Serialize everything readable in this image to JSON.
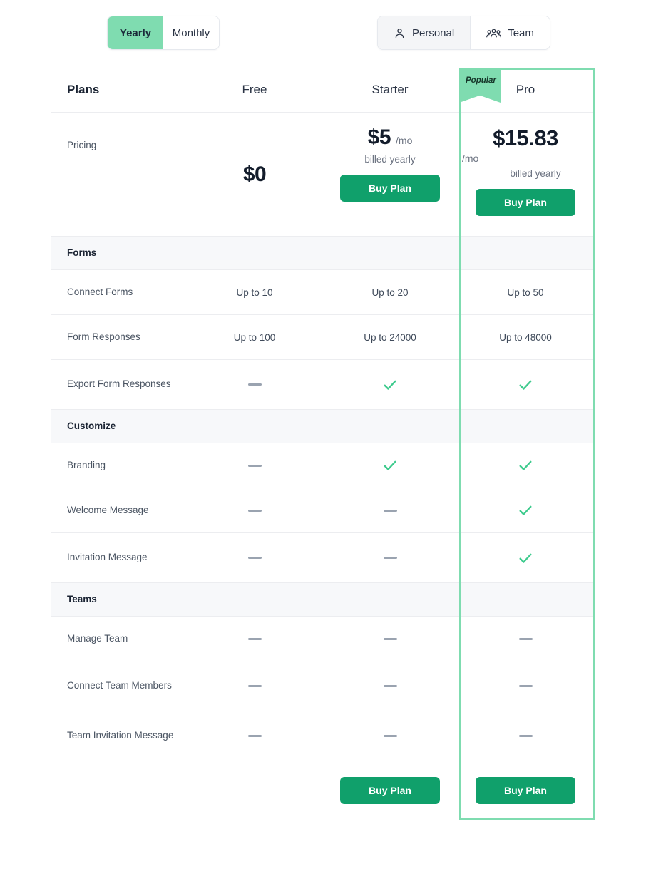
{
  "billing_toggle": {
    "name": "billing-period",
    "options": [
      {
        "label": "Yearly",
        "selected": true
      },
      {
        "label": "Monthly",
        "selected": false
      }
    ]
  },
  "audience_toggle": {
    "name": "audience-type",
    "options": [
      {
        "label": "Personal",
        "icon": "person-icon",
        "selected": true
      },
      {
        "label": "Team",
        "icon": "people-group-icon",
        "selected": false
      }
    ]
  },
  "table": {
    "header": {
      "plans_label": "Plans",
      "columns": [
        "Free",
        "Starter",
        "Pro"
      ],
      "popular_badge": "Popular",
      "popular_column": "Pro"
    },
    "pricing": {
      "label": "Pricing",
      "free": {
        "amount": "$0",
        "per": "",
        "billed": "",
        "cta": ""
      },
      "starter": {
        "amount": "$5",
        "per": "/mo",
        "billed": "billed yearly",
        "cta": "Buy Plan"
      },
      "pro": {
        "amount": "$15.83",
        "per": "/mo",
        "billed": "billed yearly",
        "cta": "Buy Plan"
      }
    },
    "sections": [
      {
        "title": "Forms",
        "rows": [
          {
            "label": "Connect Forms",
            "free": "Up to 10",
            "starter": "Up to 20",
            "pro": "Up to 50"
          },
          {
            "label": "Form Responses",
            "free": "Up to 100",
            "starter": "Up to 24000",
            "pro": "Up to 48000"
          },
          {
            "label": "Export Form Responses",
            "free": "dash",
            "starter": "check",
            "pro": "check"
          }
        ]
      },
      {
        "title": "Customize",
        "rows": [
          {
            "label": "Branding",
            "free": "dash",
            "starter": "check",
            "pro": "check"
          },
          {
            "label": "Welcome Message",
            "free": "dash",
            "starter": "dash",
            "pro": "check"
          },
          {
            "label": "Invitation Message",
            "free": "dash",
            "starter": "dash",
            "pro": "check"
          }
        ]
      },
      {
        "title": "Teams",
        "rows": [
          {
            "label": "Manage Team",
            "free": "dash",
            "starter": "dash",
            "pro": "dash"
          },
          {
            "label": "Connect Team Members",
            "free": "dash",
            "starter": "dash",
            "pro": "dash"
          },
          {
            "label": "Team Invitation Message",
            "free": "dash",
            "starter": "dash",
            "pro": "dash"
          }
        ]
      }
    ],
    "footer": {
      "free_cta": "",
      "starter_cta": "Buy Plan",
      "pro_cta": "Buy Plan"
    }
  },
  "colors": {
    "accent_light": "#7fdcb0",
    "accent_button": "#10a06b",
    "check": "#3fcb8e",
    "dash": "#9aa3b0",
    "section_bg": "#f7f8fa",
    "border": "#ecedf0",
    "text": "#2b3445"
  }
}
